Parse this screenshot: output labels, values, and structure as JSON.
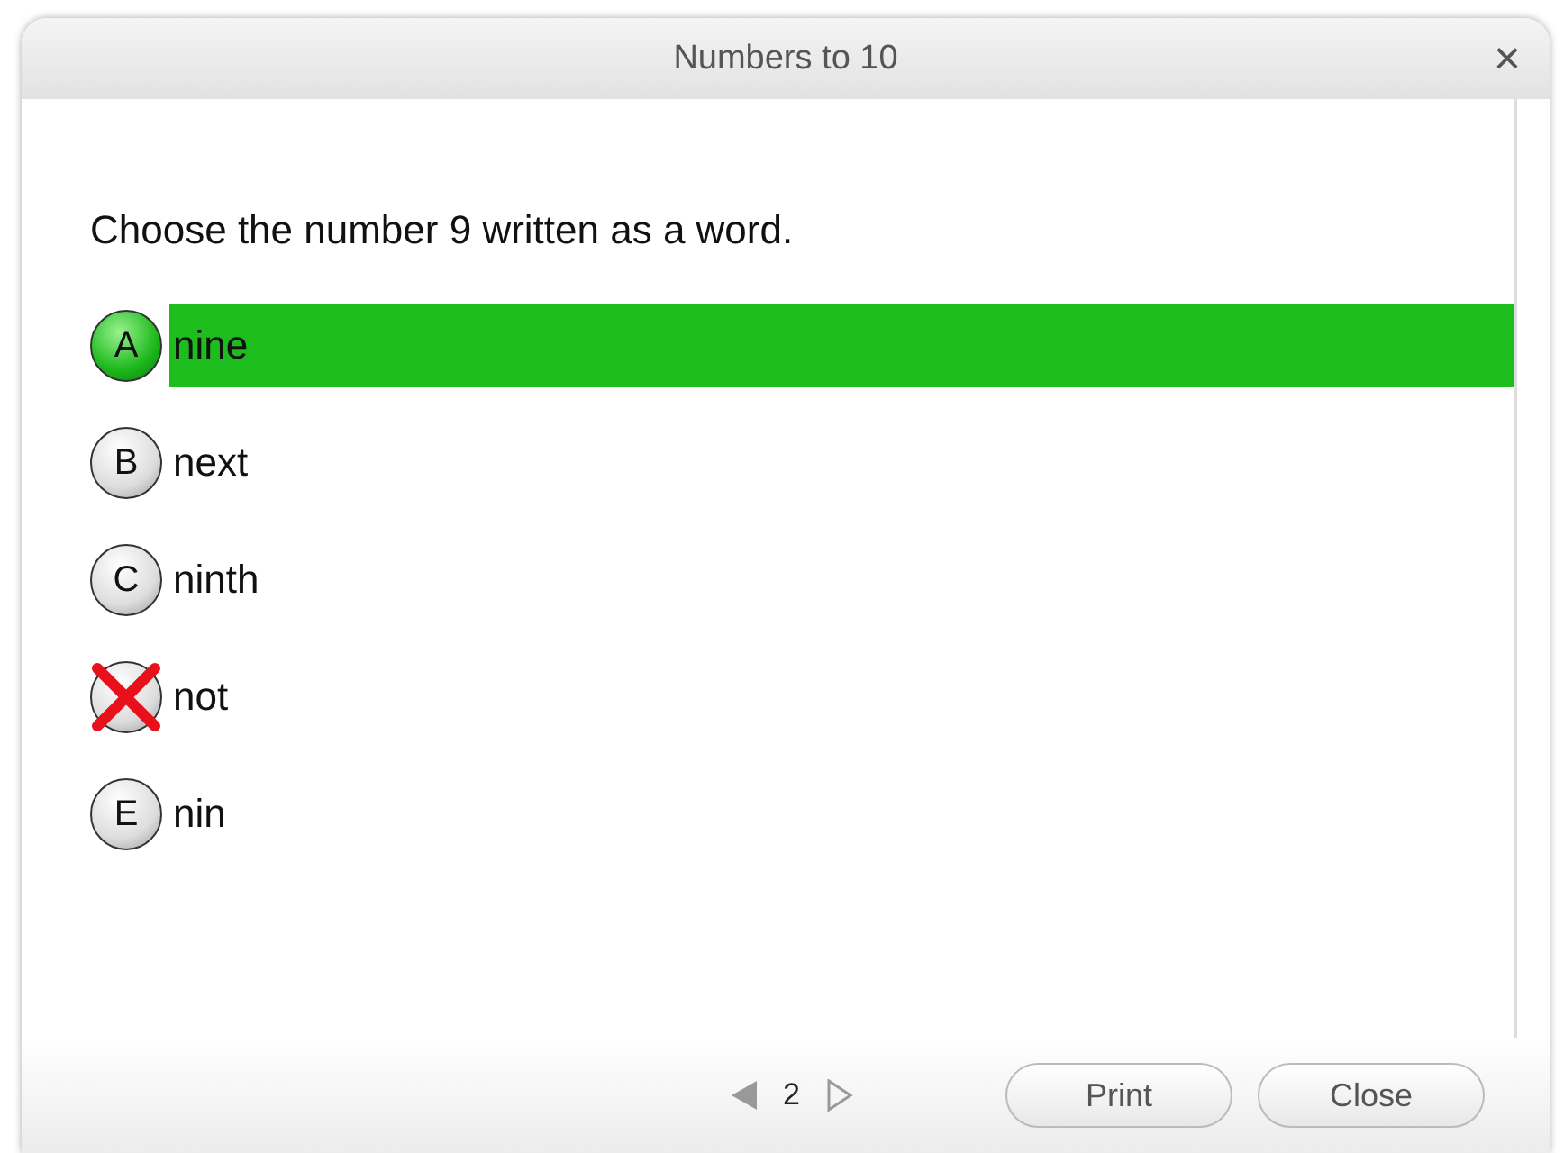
{
  "window": {
    "title": "Numbers to 10",
    "close": "×"
  },
  "question": "Choose the number 9 written as a word.",
  "options": [
    {
      "letter": "A",
      "text": "nine",
      "correct": true,
      "wrong": false
    },
    {
      "letter": "B",
      "text": "next",
      "correct": false,
      "wrong": false
    },
    {
      "letter": "C",
      "text": "ninth",
      "correct": false,
      "wrong": false
    },
    {
      "text": "not",
      "correct": false,
      "wrong": true
    },
    {
      "letter": "E",
      "text": "nin",
      "correct": false,
      "wrong": false
    }
  ],
  "pager": {
    "page": "2",
    "prev_disabled": false,
    "next_disabled": true
  },
  "buttons": [
    "Print",
    "Close"
  ]
}
